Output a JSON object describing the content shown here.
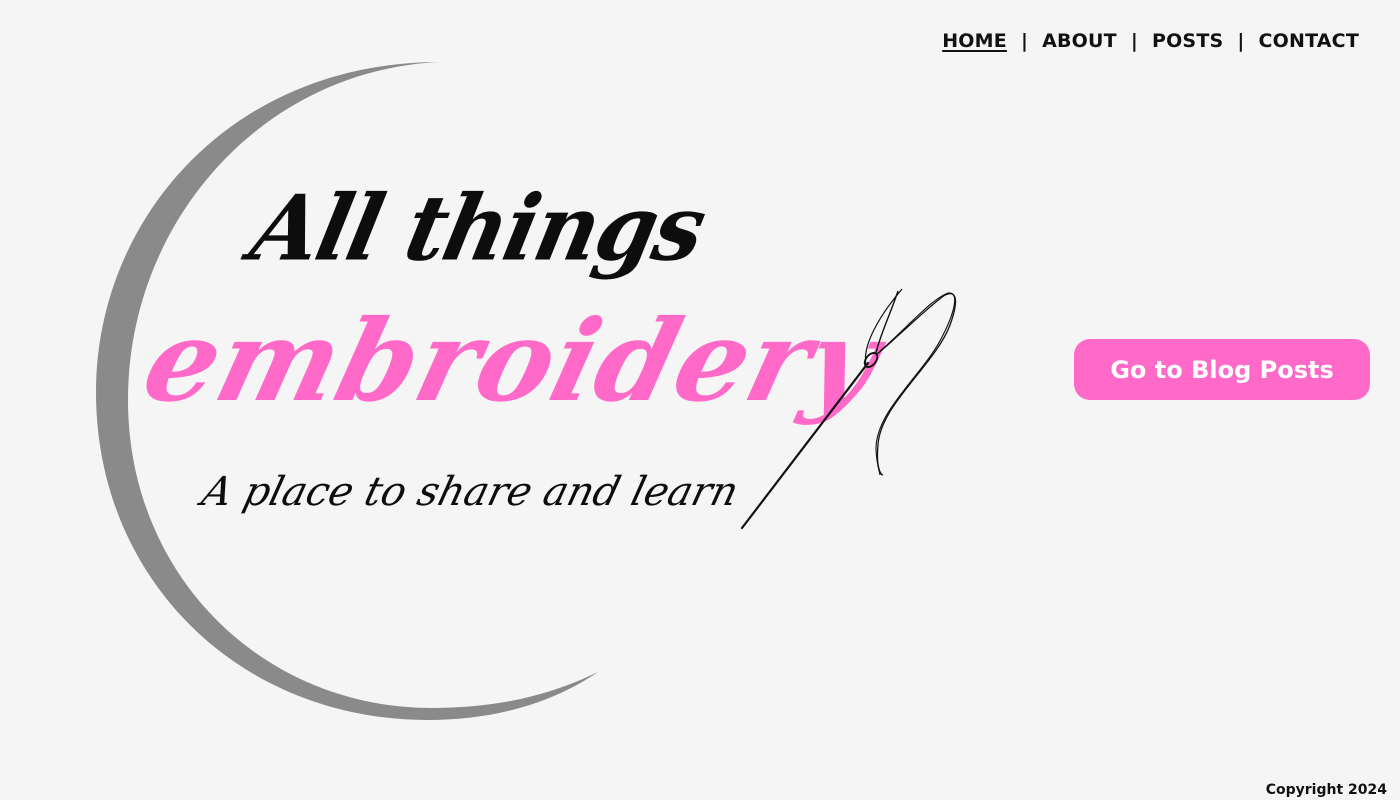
{
  "nav": {
    "items": [
      {
        "label": "HOME",
        "active": true
      },
      {
        "label": "ABOUT",
        "active": false
      },
      {
        "label": "POSTS",
        "active": false
      },
      {
        "label": "CONTACT",
        "active": false
      }
    ],
    "separator": "|"
  },
  "hero": {
    "title_top": "All things",
    "title_main": "embroidery",
    "tagline": "A place to share and learn"
  },
  "cta": {
    "label": "Go to Blog Posts"
  },
  "footer": {
    "copyright": "Copyright 2024"
  },
  "icons": {
    "crescent": "crescent-arc-icon",
    "needle": "needle-and-thread-icon"
  },
  "colors": {
    "background": "#f5f5f5",
    "accent_pink": "#ff69c8",
    "crescent_grey": "#8a8a8a",
    "text_dark": "#111111"
  }
}
